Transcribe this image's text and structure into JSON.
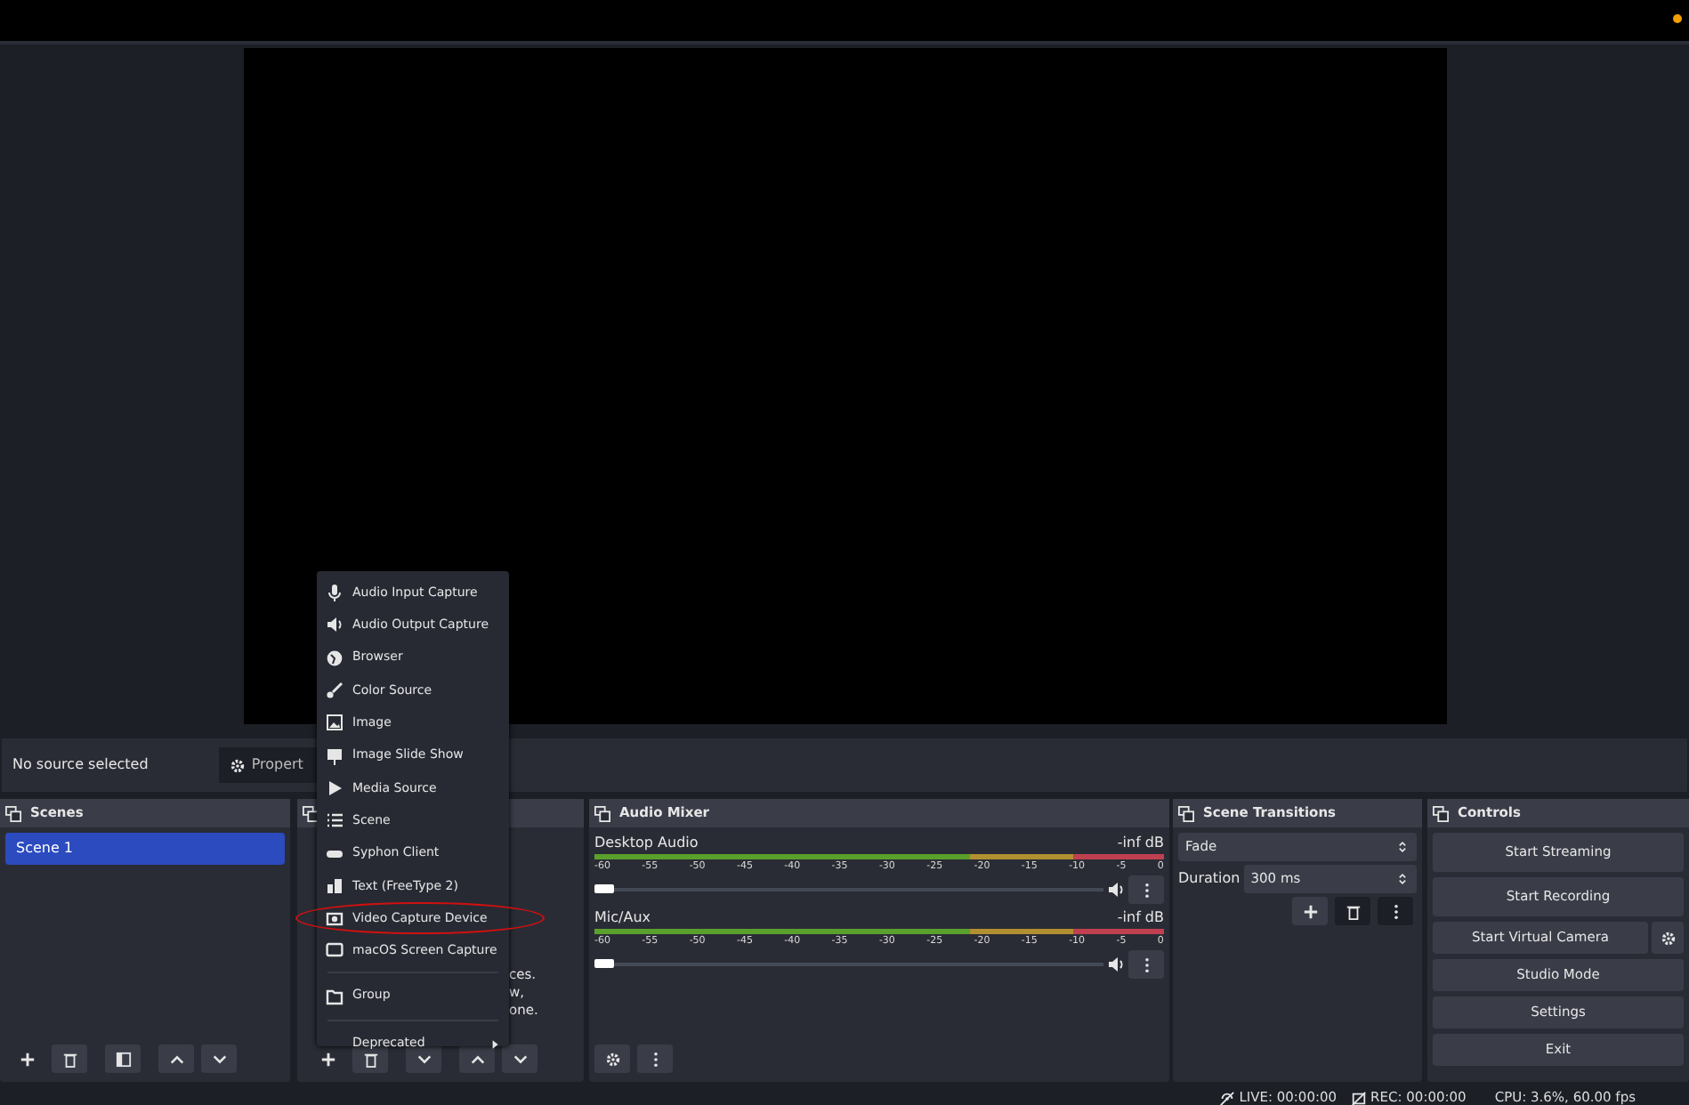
{
  "source_toolbar": {
    "status": "No source selected",
    "properties_button": "Propert"
  },
  "scenes": {
    "title": "Scenes",
    "items": [
      {
        "label": "Scene 1",
        "selected": true
      }
    ]
  },
  "sources": {
    "hint_lines": [
      "ces.",
      "w,",
      "one."
    ]
  },
  "audio_mixer": {
    "title": "Audio Mixer",
    "channels": [
      {
        "name": "Desktop Audio",
        "reading": "-inf dB",
        "level": 0,
        "scale": [
          "-60",
          "-55",
          "-50",
          "-45",
          "-40",
          "-35",
          "-30",
          "-25",
          "-20",
          "-15",
          "-10",
          "-5",
          "0"
        ]
      },
      {
        "name": "Mic/Aux",
        "reading": "-inf dB",
        "level": 0,
        "scale": [
          "-60",
          "-55",
          "-50",
          "-45",
          "-40",
          "-35",
          "-30",
          "-25",
          "-20",
          "-15",
          "-10",
          "-5",
          "0"
        ]
      }
    ]
  },
  "scene_transitions": {
    "title": "Scene Transitions",
    "transition": "Fade",
    "duration_label": "Duration",
    "duration": "300 ms"
  },
  "controls": {
    "title": "Controls",
    "buttons": [
      {
        "label": "Start Streaming"
      },
      {
        "label": "Start Recording"
      },
      {
        "label": "Start Virtual Camera"
      },
      {
        "label": "Studio Mode"
      },
      {
        "label": "Settings"
      },
      {
        "label": "Exit"
      }
    ]
  },
  "context_menu": {
    "items": [
      {
        "kind": "item",
        "label": "Audio Input Capture",
        "annotated": false
      },
      {
        "kind": "item",
        "label": "Audio Output Capture",
        "annotated": false
      },
      {
        "kind": "item",
        "label": "Browser",
        "annotated": false
      },
      {
        "kind": "item",
        "label": "Color Source",
        "annotated": false
      },
      {
        "kind": "item",
        "label": "Image",
        "annotated": false
      },
      {
        "kind": "item",
        "label": "Image Slide Show",
        "annotated": false
      },
      {
        "kind": "item",
        "label": "Media Source",
        "annotated": false
      },
      {
        "kind": "item",
        "label": "Scene",
        "annotated": false
      },
      {
        "kind": "item",
        "label": "Syphon Client",
        "annotated": false
      },
      {
        "kind": "item",
        "label": "Text (FreeType 2)",
        "annotated": false
      },
      {
        "kind": "item",
        "label": "Video Capture Device",
        "annotated": true
      },
      {
        "kind": "item",
        "label": "macOS Screen Capture",
        "annotated": false
      },
      {
        "kind": "separator"
      },
      {
        "kind": "item",
        "label": "Group",
        "annotated": false
      },
      {
        "kind": "separator"
      },
      {
        "kind": "submenu",
        "label": "Deprecated",
        "annotated": false
      }
    ]
  },
  "status_bar": {
    "live": "LIVE: 00:00:00",
    "rec": "REC: 00:00:00",
    "cpu": "CPU: 3.6%, 60.00 fps"
  }
}
